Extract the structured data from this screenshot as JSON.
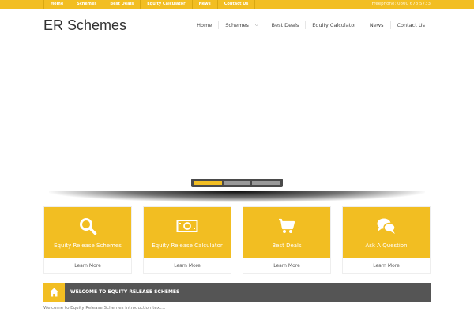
{
  "topbar": {
    "links": [
      "Home",
      "Schemes",
      "Best Deals",
      "Equity Calculator",
      "News",
      "Contact Us"
    ],
    "freephone": "Freephone: 0800 678 5733"
  },
  "header": {
    "logo": "ER Schemes",
    "nav": [
      "Home",
      "Schemes",
      "Best Deals",
      "Equity Calculator",
      "News",
      "Contact Us"
    ]
  },
  "slider": {
    "slides": 3,
    "active": 1
  },
  "features": [
    {
      "title": "Equity Release Schemes",
      "link": "Learn More",
      "icon": "search-icon"
    },
    {
      "title": "Equity Release Calculator",
      "link": "Learn More",
      "icon": "banknote-icon"
    },
    {
      "title": "Best Deals",
      "link": "Learn More",
      "icon": "cart-icon"
    },
    {
      "title": "Ask A Question",
      "link": "Learn More",
      "icon": "chat-bubbles-icon"
    }
  ],
  "welcome": {
    "title": "WELCOME TO EQUITY RELEASE SCHEMES",
    "intro": "Welcome to Equity Release Schemes introduction text..."
  },
  "colors": {
    "accent": "#f2be22",
    "dark_bar": "#555555",
    "slider_bg": "#4a4a4a"
  }
}
